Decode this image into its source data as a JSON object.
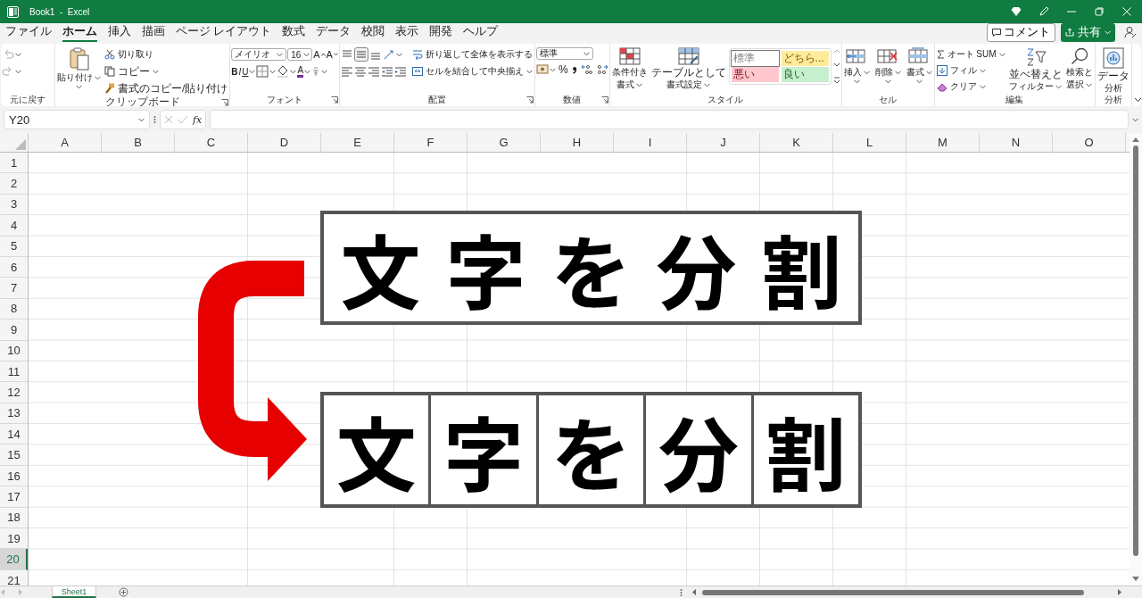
{
  "window": {
    "title": "Book1  -  Excel"
  },
  "menu_tabs": [
    {
      "label": "ファイル",
      "selected": false
    },
    {
      "label": "ホーム",
      "selected": true
    },
    {
      "label": "挿入",
      "selected": false
    },
    {
      "label": "描画",
      "selected": false
    },
    {
      "label": "ページ レイアウト",
      "selected": false
    },
    {
      "label": "数式",
      "selected": false
    },
    {
      "label": "データ",
      "selected": false
    },
    {
      "label": "校閲",
      "selected": false
    },
    {
      "label": "表示",
      "selected": false
    },
    {
      "label": "開発",
      "selected": false
    },
    {
      "label": "ヘルプ",
      "selected": false
    }
  ],
  "comment_button": "コメント",
  "share_button": "共有",
  "ribbon": {
    "groups": [
      {
        "kind": "undo",
        "label": "元に戻す"
      },
      {
        "kind": "clipboard",
        "label": "クリップボード",
        "paste": "貼り付け",
        "cut": "切り取り",
        "copy": "コピー",
        "format_painter": "書式のコピー/貼り付け"
      },
      {
        "kind": "font",
        "label": "フォント",
        "font_name": "メイリオ",
        "font_size": "16",
        "grow": "A",
        "shrink": "A",
        "bold": "B",
        "italic": "I",
        "underline": "U",
        "font_color": "A"
      },
      {
        "kind": "alignment",
        "label": "配置",
        "vertical_align": [
          {
            "selected": false
          },
          {
            "selected": true
          },
          {
            "selected": false
          }
        ],
        "wrap": "折り返して全体を表示する",
        "merge": "セルを結合して中央揃え"
      },
      {
        "kind": "number",
        "label": "数値",
        "format": "標準",
        "percent": "%"
      },
      {
        "kind": "styles",
        "label": "スタイル",
        "conditional": [
          "条件付き",
          "書式"
        ],
        "table": [
          "テーブルとして",
          "書式設定"
        ],
        "cells": [
          {
            "label": "標準",
            "color": "#ffffff"
          },
          {
            "label": "どちら...",
            "color": "#ffeb9c"
          },
          {
            "label": "悪い",
            "color": "#ffc7ce"
          },
          {
            "label": "良い",
            "color": "#c6efce"
          }
        ]
      },
      {
        "kind": "cells",
        "label": "セル",
        "buttons": [
          "挿入",
          "削除",
          "書式"
        ]
      },
      {
        "kind": "editing",
        "label": "編集",
        "autosum": "オート SUM",
        "fill": "フィル",
        "clear": "クリア",
        "sort": [
          "並べ替えと",
          "フィルター"
        ],
        "find": [
          "検索と",
          "選択"
        ]
      },
      {
        "kind": "analysis",
        "label": "分析",
        "button": [
          "データ",
          "分析"
        ]
      }
    ]
  },
  "formula_bar": {
    "name_box": "Y20",
    "function_label": "fx"
  },
  "sheet": {
    "columns": [
      "A",
      "B",
      "C",
      "D",
      "E",
      "F",
      "G",
      "H",
      "I",
      "J",
      "K",
      "L",
      "M",
      "N",
      "O"
    ],
    "rows": [
      {
        "label": "1",
        "selected": false
      },
      {
        "label": "2",
        "selected": false
      },
      {
        "label": "3",
        "selected": false
      },
      {
        "label": "4",
        "selected": false
      },
      {
        "label": "5",
        "selected": false
      },
      {
        "label": "6",
        "selected": false
      },
      {
        "label": "7",
        "selected": false
      },
      {
        "label": "8",
        "selected": false
      },
      {
        "label": "9",
        "selected": false
      },
      {
        "label": "10",
        "selected": false
      },
      {
        "label": "11",
        "selected": false
      },
      {
        "label": "12",
        "selected": false
      },
      {
        "label": "13",
        "selected": false
      },
      {
        "label": "14",
        "selected": false
      },
      {
        "label": "15",
        "selected": false
      },
      {
        "label": "16",
        "selected": false
      },
      {
        "label": "17",
        "selected": false
      },
      {
        "label": "18",
        "selected": false
      },
      {
        "label": "19",
        "selected": false
      },
      {
        "label": "20",
        "selected": true
      },
      {
        "label": "21",
        "selected": false
      }
    ]
  },
  "shapes": {
    "title_box": "文字を分割",
    "split_boxes": [
      "文",
      "字",
      "を",
      "分",
      "割"
    ]
  },
  "sheet_tabs": [
    {
      "label": "Sheet1",
      "selected": true
    }
  ]
}
